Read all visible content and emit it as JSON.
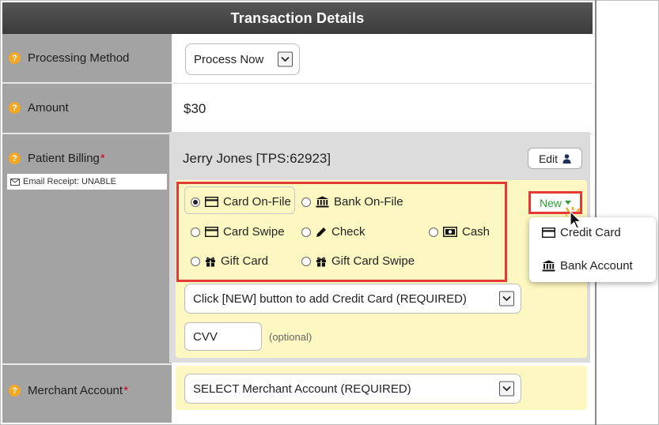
{
  "header": {
    "title": "Transaction Details"
  },
  "rows": {
    "processing": {
      "label": "Processing Method",
      "value": "Process Now"
    },
    "amount": {
      "label": "Amount",
      "value": "$30"
    },
    "billing": {
      "label": "Patient Billing",
      "required_mark": "*",
      "email_receipt": "Email Receipt: UNABLE",
      "patient": "Jerry Jones [TPS:62923]",
      "edit_label": "Edit"
    },
    "merchant": {
      "label": "Merchant Account",
      "required_mark": "*",
      "value": "SELECT Merchant Account (REQUIRED)"
    }
  },
  "payment_options": {
    "card_on_file": "Card On-File",
    "bank_on_file": "Bank On-File",
    "card_swipe": "Card Swipe",
    "check": "Check",
    "cash": "Cash",
    "gift_card": "Gift Card",
    "gift_card_swipe": "Gift Card Swipe",
    "selected": "Card On-File"
  },
  "new_button": {
    "label": "New"
  },
  "new_menu": {
    "credit_card": "Credit Card",
    "bank_account": "Bank Account"
  },
  "card_select": {
    "value": "Click [NEW] button to add Credit Card (REQUIRED)"
  },
  "cvv": {
    "value": "CVV",
    "hint": "(optional)"
  },
  "colors": {
    "accent_red": "#e53935",
    "label_bg": "#a3a3a3",
    "highlight_yellow": "#fdf8c2",
    "new_green": "#2e9e2e"
  }
}
